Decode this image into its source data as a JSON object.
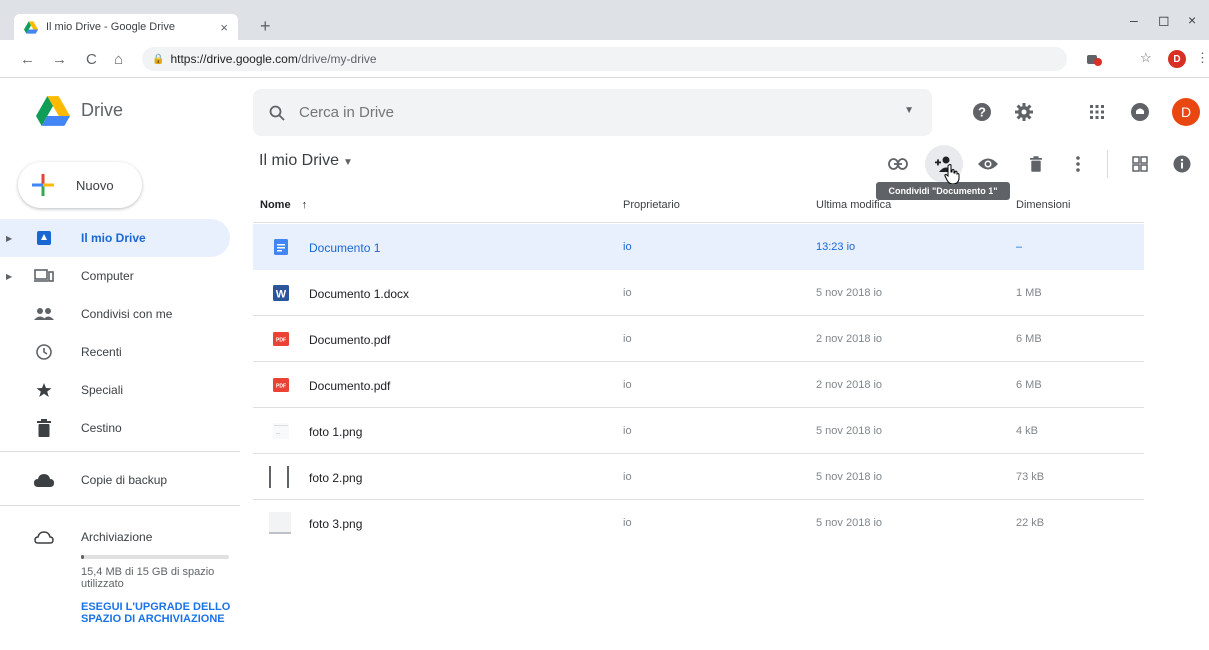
{
  "browser": {
    "tab_title": "Il mio Drive - Google Drive",
    "tab_close": "×",
    "new_tab": "+",
    "window_controls": [
      "–",
      "◻",
      "×"
    ],
    "nav": [
      "←",
      "→",
      "C",
      "⌂"
    ],
    "url_host": "https://drive.google.com",
    "url_path": "/drive/my-drive",
    "star": "☆",
    "menu": "⋮",
    "profile_initial": "D"
  },
  "header": {
    "app_name": "Drive",
    "search_placeholder": "Cerca in Drive",
    "avatar_initial": "D"
  },
  "sidebar": {
    "new_button": "Nuovo",
    "items": [
      {
        "label": "Il mio Drive",
        "icon": "my-drive-icon",
        "active": true
      },
      {
        "label": "Computer",
        "icon": "computer-icon"
      },
      {
        "label": "Condivisi con me",
        "icon": "shared-icon"
      },
      {
        "label": "Recenti",
        "icon": "clock-icon"
      },
      {
        "label": "Speciali",
        "icon": "star-icon"
      },
      {
        "label": "Cestino",
        "icon": "trash-icon"
      },
      {
        "label": "Copie di backup",
        "icon": "cloud-icon"
      },
      {
        "label": "Archiviazione",
        "icon": "cloud-outline-icon"
      }
    ],
    "storage_used_fraction": 0.01,
    "storage_text": "15,4 MB di 15 GB di spazio utilizzato",
    "upgrade_link": "ESEGUI L'UPGRADE DELLO SPAZIO DI ARCHIVIAZIONE"
  },
  "main": {
    "breadcrumb": "Il mio Drive",
    "tooltip": "Condividi \"Documento 1\"",
    "columns": {
      "name": "Nome",
      "sort_arrow": "↑",
      "owner": "Proprietario",
      "modified": "Ultima modifica",
      "size": "Dimensioni"
    },
    "rows": [
      {
        "name": "Documento 1",
        "type": "gdoc",
        "owner": "io",
        "modified": "13:23 io",
        "size": "–"
      },
      {
        "name": "Documento 1.docx",
        "type": "word",
        "owner": "io",
        "modified": "5 nov 2018 io",
        "size": "1 MB"
      },
      {
        "name": "Documento.pdf",
        "type": "pdf",
        "owner": "io",
        "modified": "2 nov 2018 io",
        "size": "6 MB"
      },
      {
        "name": "Documento.pdf",
        "type": "pdf",
        "owner": "io",
        "modified": "2 nov 2018 io",
        "size": "6 MB"
      },
      {
        "name": "foto 1.png",
        "type": "image",
        "owner": "io",
        "modified": "5 nov 2018 io",
        "size": "4 kB"
      },
      {
        "name": "foto 2.png",
        "type": "image",
        "owner": "io",
        "modified": "5 nov 2018 io",
        "size": "73 kB"
      },
      {
        "name": "foto 3.png",
        "type": "image",
        "owner": "io",
        "modified": "5 nov 2018 io",
        "size": "22 kB"
      }
    ]
  },
  "colors": {
    "accent": "#1a73e8",
    "selected_bg": "#e8f0fe",
    "pdf_red": "#ea4335",
    "word_blue": "#2a5699",
    "avatar": "#e8470f"
  }
}
